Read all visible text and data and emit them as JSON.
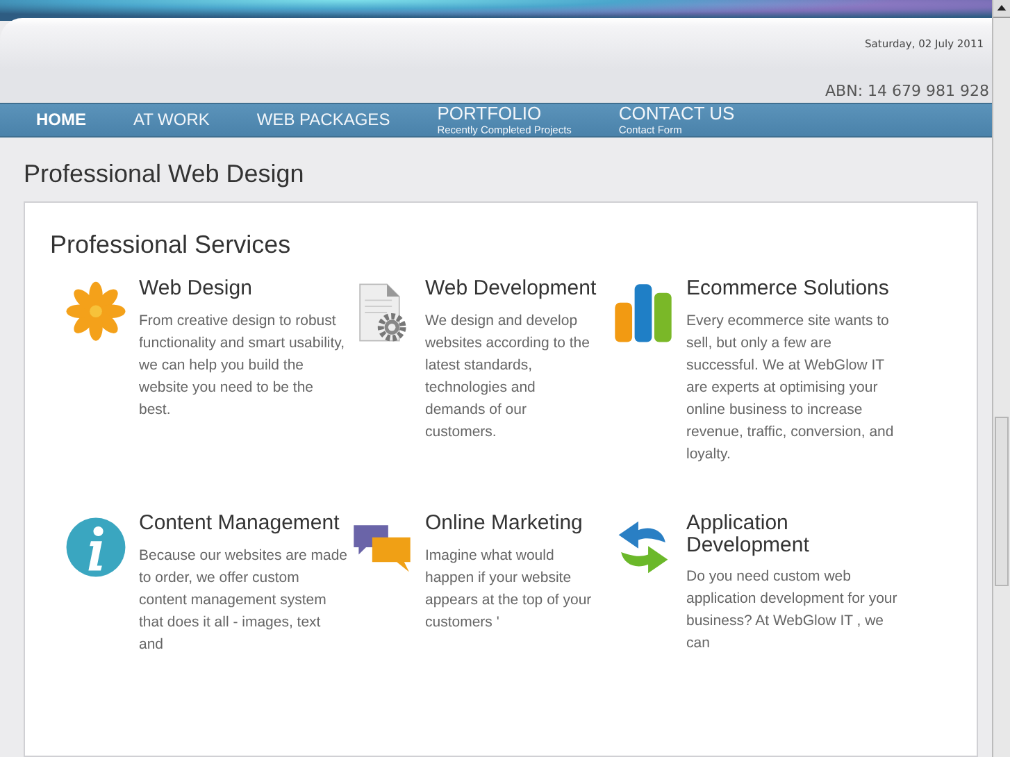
{
  "header": {
    "date": "Saturday, 02 July 2011",
    "abn": "ABN: 14 679 981 928"
  },
  "nav": [
    {
      "label": "HOME",
      "selected": true
    },
    {
      "label": "AT WORK",
      "selected": false
    },
    {
      "label": "WEB PACKAGES",
      "selected": false
    },
    {
      "label": "PORTFOLIO",
      "subtitle": "Recently Completed Projects",
      "selected": false
    },
    {
      "label": "CONTACT US",
      "subtitle": "Contact Form",
      "selected": false
    }
  ],
  "page_title": "Professional Web Design",
  "section_title": "Professional Services",
  "services": [
    {
      "kind": "flower",
      "title": "Web Design",
      "text": "From creative design to robust functionality and smart usability, we can help you build the website you need to be the best."
    },
    {
      "kind": "document",
      "title": "Web Development",
      "text": "We design and develop websites according to the latest standards, technologies and demands of our customers."
    },
    {
      "kind": "chart",
      "title": "Ecommerce Solutions",
      "text": "Every ecommerce site wants to sell, but only a few are successful. We at WebGlow IT are experts at optimising your online business to increase revenue, traffic, conversion, and loyalty."
    },
    {
      "kind": "info",
      "title": "Content Management",
      "text": "Because our websites are made to order, we offer custom content management system that does it all - images, text and"
    },
    {
      "kind": "chat",
      "title": "Online Marketing",
      "text": "Imagine what would happen if your website appears at the top of your customers '"
    },
    {
      "kind": "arrows",
      "title": "Application Development",
      "text": "Do you need custom web application development for your business? At WebGlow IT , we can"
    }
  ]
}
